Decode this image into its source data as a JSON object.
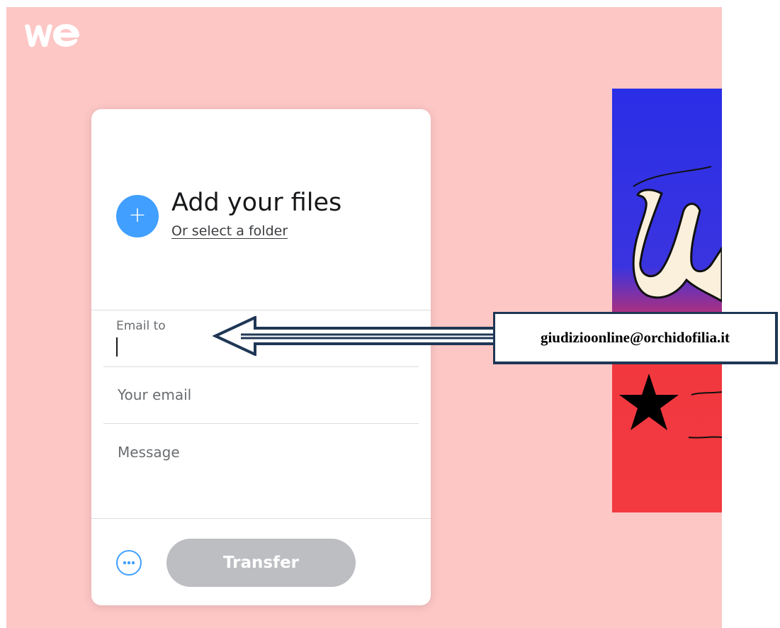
{
  "brand": {
    "logo_text": "we"
  },
  "upload": {
    "add_files": "Add your files",
    "select_folder": "Or select a folder",
    "add_icon": "plus-icon"
  },
  "form": {
    "email_to_label": "Email to",
    "your_email_placeholder": "Your email",
    "message_placeholder": "Message"
  },
  "actions": {
    "more_icon": "ellipsis-icon",
    "transfer_label": "Transfer"
  },
  "annotation": {
    "email_text": "giudizioonline@orchidofilia.it"
  },
  "colors": {
    "background": "#fdc7c6",
    "accent": "#409fff",
    "disabled_button": "#bdbec2",
    "annotation_border": "#1f3755",
    "ad_blue": "#2a2ee6",
    "ad_red": "#f2373f"
  }
}
